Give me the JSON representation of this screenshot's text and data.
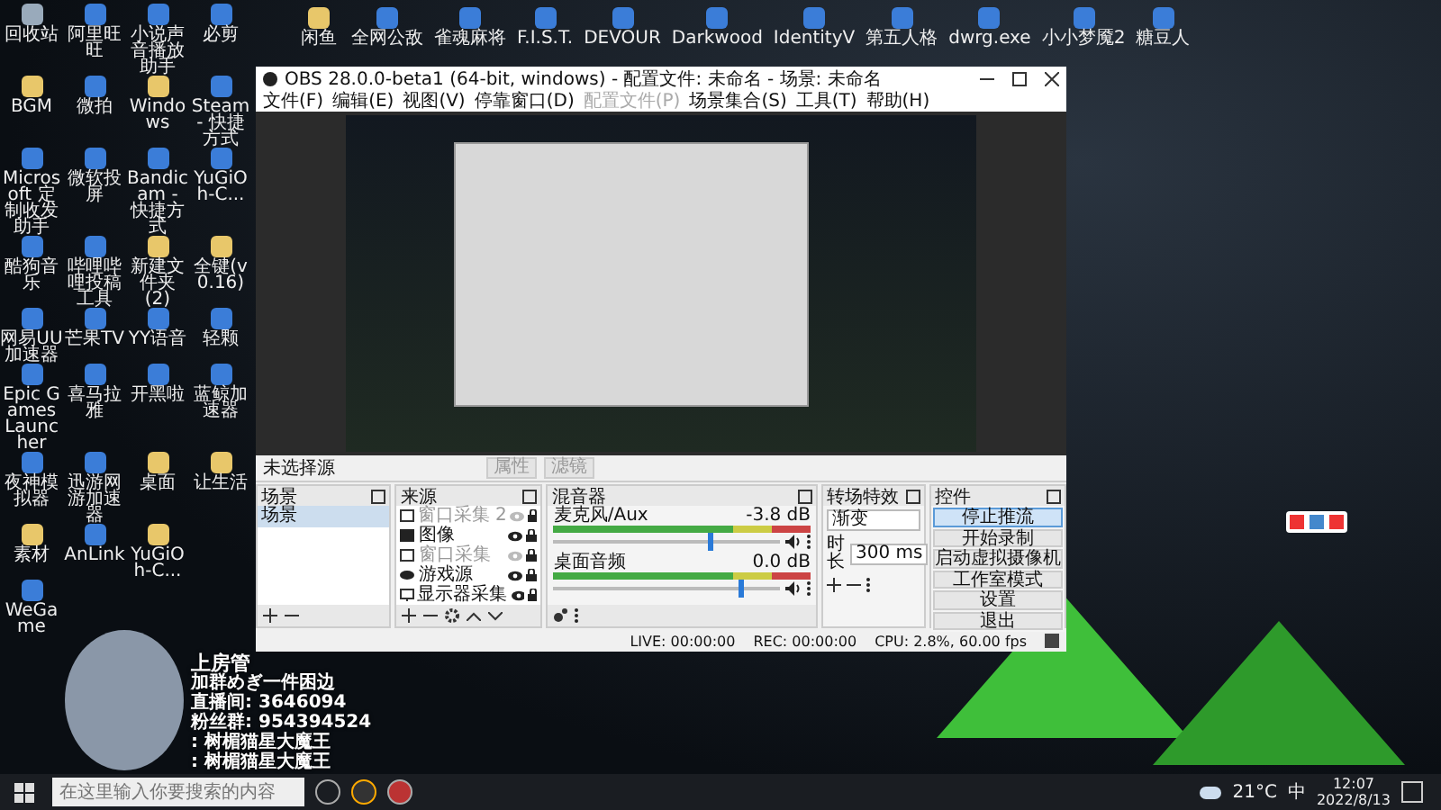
{
  "desktop_icons": [
    {
      "label": "回收站",
      "kind": "bin"
    },
    {
      "label": "阿里旺旺",
      "kind": "app"
    },
    {
      "label": "小说声音播放助手",
      "kind": "app"
    },
    {
      "label": "必剪",
      "kind": "app"
    },
    {
      "label": "BGM",
      "kind": "folder"
    },
    {
      "label": "微拍",
      "kind": "app"
    },
    {
      "label": "Windows",
      "kind": "folder"
    },
    {
      "label": "Steam - 快捷方式",
      "kind": "app"
    },
    {
      "label": "Microsoft 定制收发助手",
      "kind": "app"
    },
    {
      "label": "微软投屏",
      "kind": "app"
    },
    {
      "label": "Bandicam - 快捷方式",
      "kind": "app"
    },
    {
      "label": "YuGiOh-C...",
      "kind": "app"
    },
    {
      "label": "酷狗音乐",
      "kind": "app"
    },
    {
      "label": "哔哩哔哩投稿工具",
      "kind": "app"
    },
    {
      "label": "新建文件夹 (2)",
      "kind": "folder"
    },
    {
      "label": "全键(v0.16)",
      "kind": "folder"
    },
    {
      "label": "网易UU加速器",
      "kind": "app"
    },
    {
      "label": "芒果TV",
      "kind": "app"
    },
    {
      "label": "YY语音",
      "kind": "app"
    },
    {
      "label": "轻颗",
      "kind": "app"
    },
    {
      "label": "Epic Games Launcher",
      "kind": "app"
    },
    {
      "label": "喜马拉雅",
      "kind": "app"
    },
    {
      "label": "开黑啦",
      "kind": "app"
    },
    {
      "label": "蓝鲸加速器",
      "kind": "app"
    },
    {
      "label": "夜神模拟器",
      "kind": "app"
    },
    {
      "label": "迅游网游加速器",
      "kind": "app"
    },
    {
      "label": "桌面",
      "kind": "folder"
    },
    {
      "label": "让生活",
      "kind": "folder"
    },
    {
      "label": "素材",
      "kind": "folder"
    },
    {
      "label": "AnLink",
      "kind": "app"
    },
    {
      "label": "YuGiOh-C...",
      "kind": "folder"
    },
    {
      "label": "WeGame",
      "kind": "app"
    }
  ],
  "top_icons": [
    {
      "label": "闲鱼",
      "kind": "folder"
    },
    {
      "label": "全网公敌",
      "kind": "app"
    },
    {
      "label": "雀魂麻将",
      "kind": "app"
    },
    {
      "label": "F.I.S.T.",
      "kind": "app"
    },
    {
      "label": "DEVOUR",
      "kind": "app"
    },
    {
      "label": "Darkwood",
      "kind": "app"
    },
    {
      "label": "IdentityV",
      "kind": "app"
    },
    {
      "label": "第五人格",
      "kind": "app"
    },
    {
      "label": "dwrg.exe",
      "kind": "app"
    },
    {
      "label": "小小梦魇2",
      "kind": "app"
    },
    {
      "label": "糖豆人",
      "kind": "app"
    }
  ],
  "obs": {
    "title": "OBS 28.0.0-beta1 (64-bit, windows) - 配置文件: 未命名 - 场景: 未命名",
    "menu": [
      {
        "label": "文件(F)",
        "disabled": false
      },
      {
        "label": "编辑(E)",
        "disabled": false
      },
      {
        "label": "视图(V)",
        "disabled": false
      },
      {
        "label": "停靠窗口(D)",
        "disabled": false
      },
      {
        "label": "配置文件(P)",
        "disabled": true
      },
      {
        "label": "场景集合(S)",
        "disabled": false
      },
      {
        "label": "工具(T)",
        "disabled": false
      },
      {
        "label": "帮助(H)",
        "disabled": false
      }
    ],
    "source_toolbar": {
      "label": "未选择源",
      "buttons": [
        "属性",
        "滤镜"
      ]
    },
    "scenes": {
      "title": "场景",
      "items": [
        {
          "label": "场景",
          "selected": true
        }
      ]
    },
    "sources": {
      "title": "来源",
      "items": [
        {
          "label": "窗口采集 2",
          "kind": "window",
          "visible": false
        },
        {
          "label": "图像",
          "kind": "image",
          "visible": true
        },
        {
          "label": "窗口采集",
          "kind": "window",
          "visible": false
        },
        {
          "label": "游戏源",
          "kind": "game",
          "visible": true
        },
        {
          "label": "显示器采集",
          "kind": "monitor",
          "visible": true
        }
      ]
    },
    "mixer": {
      "title": "混音器",
      "channels": [
        {
          "name": "麦克风/Aux",
          "reading": "-3.8 dB",
          "level": 0.68
        },
        {
          "name": "桌面音频",
          "reading": "0.0 dB",
          "level": 0.82
        }
      ]
    },
    "transitions": {
      "title": "转场特效",
      "type": "渐变",
      "duration_label": "时长",
      "duration": "300 ms"
    },
    "controls": {
      "title": "控件",
      "buttons": [
        {
          "label": "停止推流",
          "selected": true
        },
        {
          "label": "开始录制",
          "selected": false
        },
        {
          "label": "启动虚拟摄像机",
          "selected": false
        },
        {
          "label": "工作室模式",
          "selected": false
        },
        {
          "label": "设置",
          "selected": false
        },
        {
          "label": "退出",
          "selected": false
        }
      ]
    },
    "status_bar": {
      "live": "LIVE: 00:00:00",
      "rec": "REC: 00:00:00",
      "cpu": "CPU: 2.8%, 60.00 fps"
    }
  },
  "overlay": {
    "lines": [
      {
        "kind": "title",
        "text": "上房管"
      },
      {
        "kind": "plain",
        "text": "加群めぎ一件困边"
      },
      {
        "kind": "plain",
        "text": "直播间: 3646094"
      },
      {
        "kind": "plain",
        "text": "粉丝群: 954394524"
      },
      {
        "kind": "plain",
        "text": ": 树楣猫星大魔王"
      },
      {
        "kind": "plain",
        "text": ": 树楣猫星大魔王"
      }
    ]
  },
  "taskbar": {
    "search_placeholder": "在这里输入你要搜索的内容",
    "weather": "21°C",
    "ime": "中",
    "time": "12:07",
    "date": "2022/8/13"
  }
}
